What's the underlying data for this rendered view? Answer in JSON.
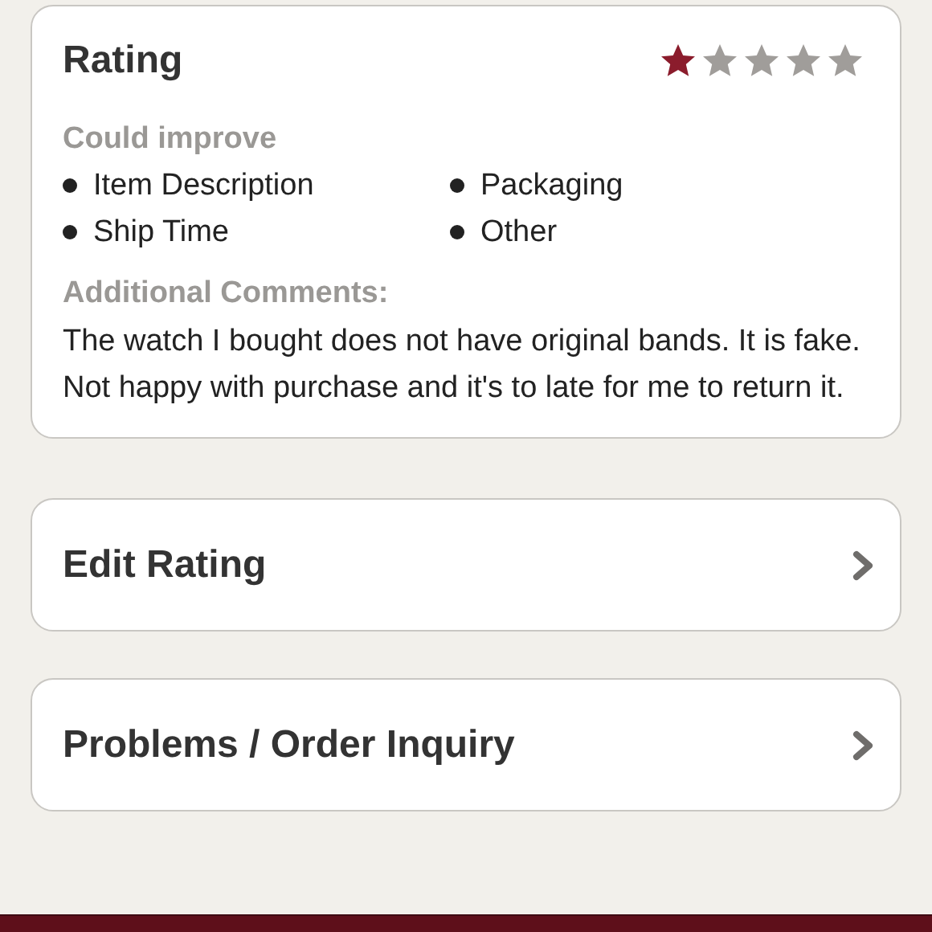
{
  "rating": {
    "title": "Rating",
    "stars": 1
  },
  "could_improve": {
    "heading": "Could improve",
    "items": [
      "Item Description",
      "Packaging",
      "Ship Time",
      "Other"
    ]
  },
  "comments": {
    "heading": "Additional Comments:",
    "text": "The watch I bought does not have original bands. It is fake. Not happy with purchase and it's to late for me to return it."
  },
  "actions": [
    {
      "label": "Edit Rating"
    },
    {
      "label": "Problems / Order Inquiry"
    }
  ]
}
